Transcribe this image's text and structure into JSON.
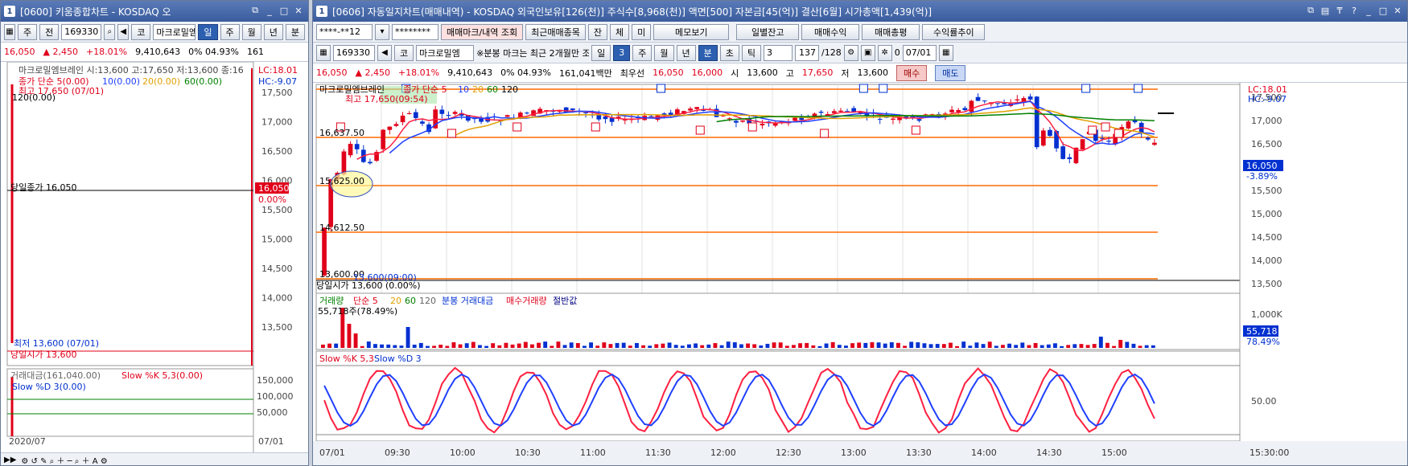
{
  "left_window": {
    "num": "1",
    "title": "[0600] 키움종합차트 - KOSDAQ 오",
    "toolbar": {
      "mode": "주",
      "prev": "전",
      "code": "169330",
      "market_btn": "코",
      "name": "마크로밀엠",
      "periods": [
        "일",
        "주",
        "월",
        "년",
        "분"
      ]
    },
    "pricebar": {
      "price": "16,050",
      "change": "▲ 2,450",
      "rate": "+18.01%",
      "volume": "9,410,643",
      "ratio": "0% 04.93%",
      "extra": "161"
    },
    "chart": {
      "title": "마크로밀엠브레인 시:13,600 고:17,650 저:13,600 종:16",
      "ma_legend": [
        "종가 단순 5(0.00)",
        "10(0.00)",
        "20(0.00)",
        "60(0.00)"
      ],
      "high_note": "최고 17,650 (07/01)",
      "left_val": "120(0.00)",
      "close_label": "당일종가 16,050",
      "low_note": "최저 13,600 (07/01)",
      "open_label": "당일시가 13,600",
      "lc": "LC:18.01",
      "hc": "HC:-9.07",
      "price_ticks": [
        "17,500",
        "17,000",
        "16,500",
        "16,000",
        "15,500",
        "15,000",
        "14,500",
        "14,000",
        "13,500"
      ],
      "current_price": "16,050",
      "current_rate": "0.00%",
      "sub_legend": [
        "거래대금(161,040.00)",
        "Slow %K 5,3(0.00)"
      ],
      "sub_legend2": "Slow %D 3(0.00)",
      "sub_ticks": [
        "150,000",
        "100,000",
        "50,000"
      ],
      "date_left": "2020/07",
      "date_right": "07/01"
    }
  },
  "right_window": {
    "num": "1",
    "title": "[0606] 자동일지차트(매매내역) - KOSDAQ 외국인보유[126(천)] 주식수[8,968(천)] 액면[500] 자본금[45(억)] 결산[6월] 시가총액[1,439(억)]",
    "toolbar1": {
      "account": "****-**12",
      "password": "********",
      "buttons": [
        "매매마크/내역 조회",
        "최근매매종목",
        "잔",
        "체",
        "미",
        "메모보기",
        "일별잔고",
        "매매수익",
        "매매총평",
        "수익률추이"
      ]
    },
    "toolbar2": {
      "code": "169330",
      "market_btn": "코",
      "name": "마크로밀엠",
      "note": "※분봉 마크는 최근 2개월만 조회",
      "periods": [
        "일",
        "3",
        "주",
        "월",
        "년",
        "분",
        "초",
        "틱"
      ],
      "minute": "3",
      "count": "137",
      "count_total": "/128",
      "check_label": "0",
      "date": "07/01"
    },
    "pricebar": {
      "price": "16,050",
      "change": "▲ 2,450",
      "rate": "+18.01%",
      "volume": "9,410,643",
      "ratio": "0% 04.93%",
      "amount": "161,041백만",
      "best_label": "최우선",
      "bid": "16,050",
      "ask": "16,000",
      "open_label": "시",
      "open": "13,600",
      "high_label": "고",
      "high": "17,650",
      "low_label": "저",
      "low": "13,600",
      "buy": "매수",
      "sell": "매도"
    },
    "chart": {
      "legend_name": "마크로밀엠브레인",
      "ma_legend": [
        "종가 단순 5",
        "10",
        "20",
        "60",
        "120"
      ],
      "high_note": "최고 17,650(09:54)",
      "level_labels": [
        "16,637.50",
        "15,625.00",
        "14,612.50",
        "13,600.00"
      ],
      "open_note": "13,600(09:00)",
      "open_label": "당일시가 13,600 (0.00%)",
      "lc": "LC:18.01",
      "hc": "HC:-9.07",
      "price_ticks": [
        "17,500",
        "17,000",
        "16,500",
        "16,000",
        "15,500",
        "15,000",
        "14,500",
        "14,000",
        "13,500"
      ],
      "current_price": "16,050",
      "current_rate": "-3.89%",
      "vol_legend": [
        "거래량",
        "단순 5",
        "20",
        "60",
        "120",
        "분봉 거래대금",
        "매수거래량",
        "절반값"
      ],
      "vol_note": "55,718주(78.49%)",
      "vol_ticks": [
        "1,000K"
      ],
      "vol_current": "55,718",
      "vol_rate": "78.49%",
      "stoch_legend": [
        "Slow %K 5,3",
        "Slow %D 3"
      ],
      "stoch_ticks": [
        "50.00"
      ],
      "time_labels": [
        "07/01",
        "09:30",
        "10:00",
        "10:30",
        "11:00",
        "11:30",
        "12:00",
        "12:30",
        "13:00",
        "13:30",
        "14:00",
        "14:30",
        "15:00",
        "15:30:00"
      ]
    }
  },
  "colors": {
    "up": "#e0001a",
    "down": "#0030d0",
    "ma5": "#ff2040",
    "ma10": "#2040ff",
    "ma20": "#e0a000",
    "ma60": "#008000",
    "ma120": "#000000",
    "level_line": "#ff6a00"
  }
}
